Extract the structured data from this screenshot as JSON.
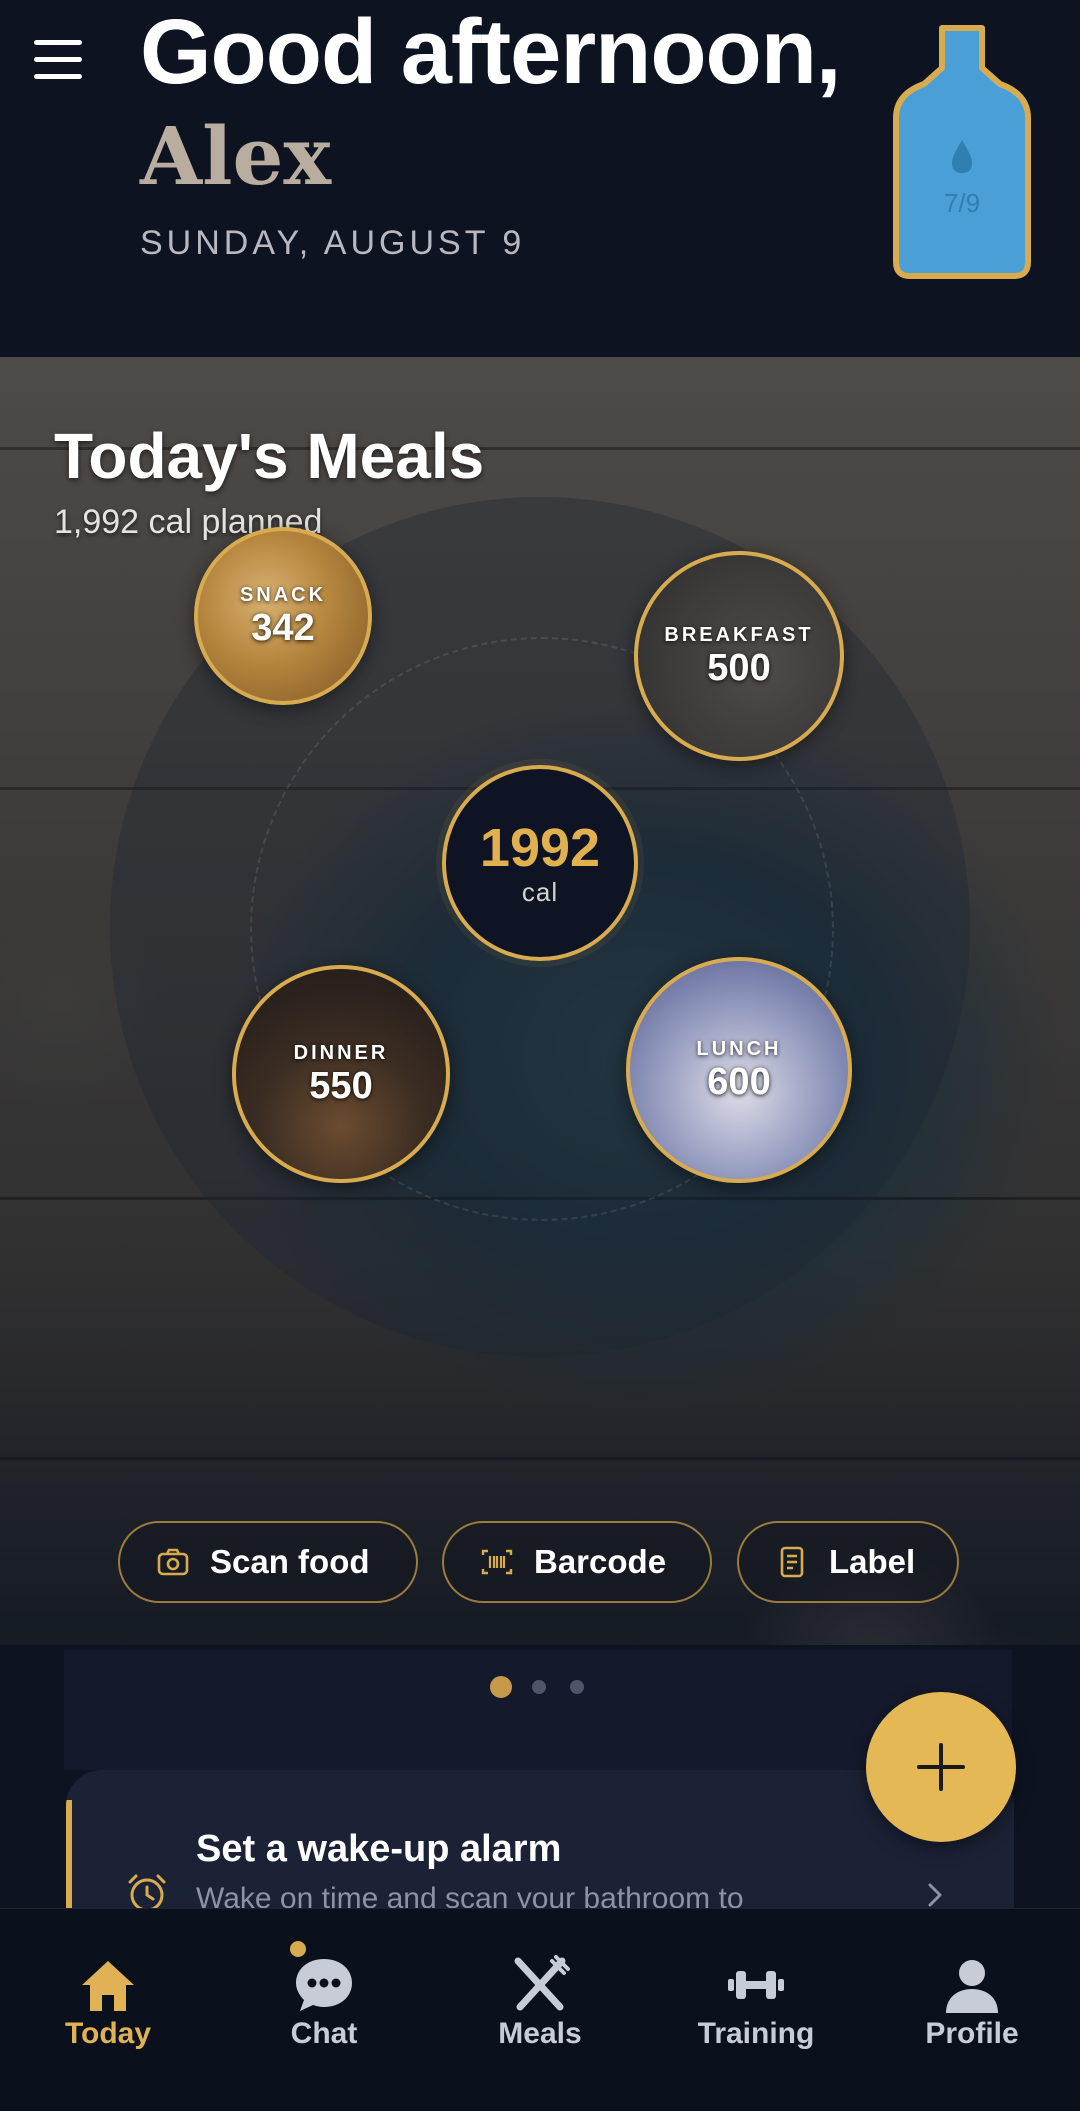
{
  "header": {
    "greeting": "Good afternoon,",
    "name": "Alex",
    "date": "SUNDAY, AUGUST 9",
    "water": {
      "count_label": "7/9",
      "progress": 0.78
    }
  },
  "meals": {
    "title": "Today's Meals",
    "subtitle": "1,992 cal planned",
    "total": {
      "value": "1992",
      "unit": "cal"
    },
    "items": [
      {
        "label": "SNACK",
        "value": "342"
      },
      {
        "label": "BREAKFAST",
        "value": "500"
      },
      {
        "label": "DINNER",
        "value": "550"
      },
      {
        "label": "LUNCH",
        "value": "600"
      }
    ],
    "actions": [
      {
        "label": "Scan food",
        "icon": "camera-icon"
      },
      {
        "label": "Barcode",
        "icon": "barcode-icon"
      },
      {
        "label": "Label",
        "icon": "label-icon"
      }
    ]
  },
  "pagination": {
    "count": 3,
    "active": 0
  },
  "alarm_card": {
    "title": "Set a wake-up alarm",
    "subtitle": "Wake on time and scan your bathroom to",
    "icon": "alarm-clock-icon"
  },
  "fab": {
    "icon": "plus-icon"
  },
  "nav": {
    "items": [
      {
        "label": "Today",
        "icon": "home-icon",
        "active": true
      },
      {
        "label": "Chat",
        "icon": "chat-icon",
        "badge": true
      },
      {
        "label": "Meals",
        "icon": "fork-knife-icon"
      },
      {
        "label": "Training",
        "icon": "dumbbell-icon"
      },
      {
        "label": "Profile",
        "icon": "person-icon"
      }
    ]
  },
  "colors": {
    "accent": "#d9ab4f",
    "background": "#0e1322",
    "water": "#4a9fd6"
  }
}
